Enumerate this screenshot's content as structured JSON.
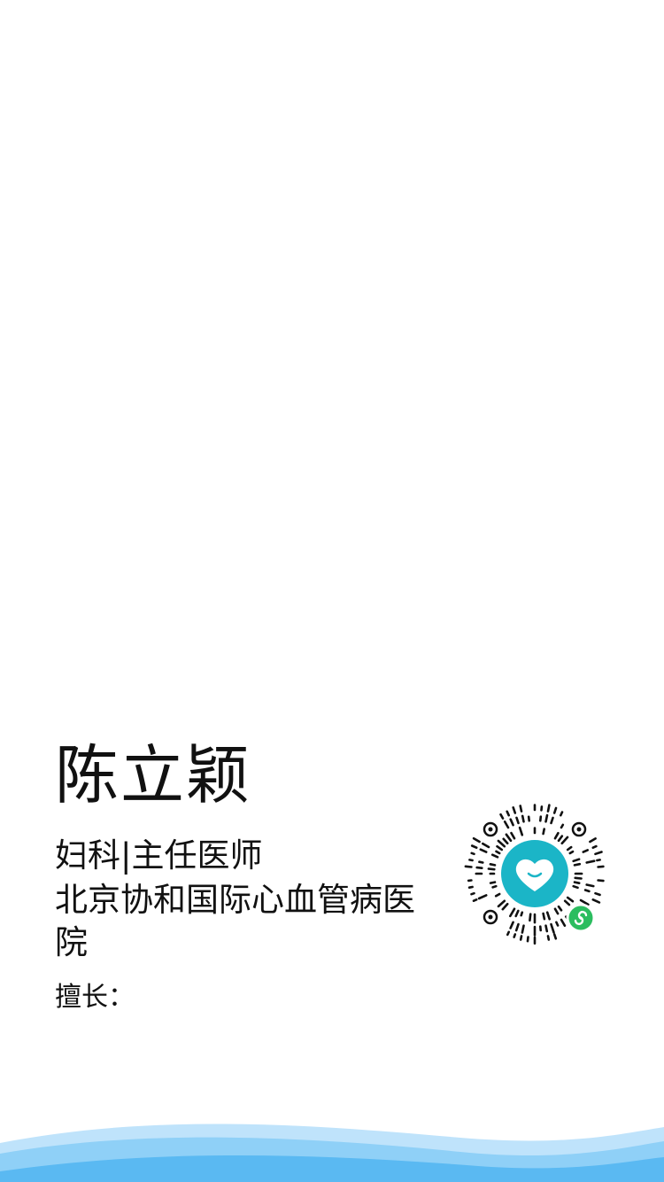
{
  "doctor": {
    "name": "陈立颖",
    "department": "妇科",
    "separator": "|",
    "title": "主任医师",
    "hospital": "北京协和国际心血管病医院",
    "specialty_label": "擅长：",
    "specialty_value": ""
  },
  "qr": {
    "icon": "heart-smile-icon",
    "badge_icon": "mini-program-icon",
    "accent_color": "#1bb5c7",
    "badge_color": "#2bbd5f"
  },
  "decor": {
    "wave_colors": [
      "#bfe3fb",
      "#8fd0f7",
      "#5ab9f2"
    ]
  }
}
